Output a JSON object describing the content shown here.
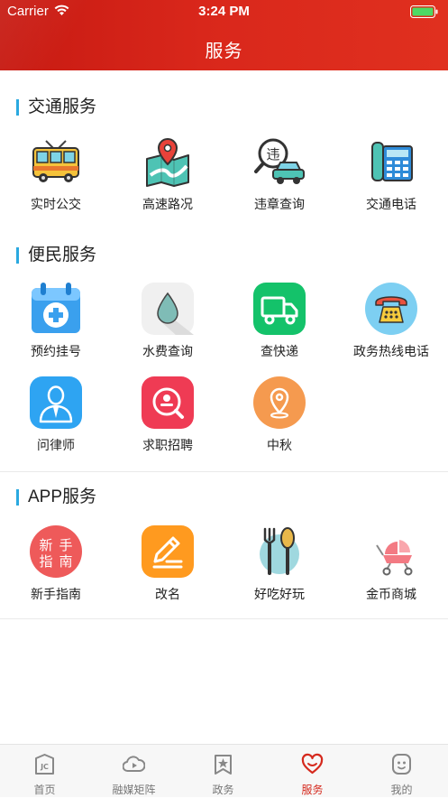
{
  "status_bar": {
    "carrier": "Carrier",
    "time": "3:24 PM"
  },
  "header": {
    "title": "服务"
  },
  "sections": {
    "traffic": {
      "title": "交通服务",
      "items": [
        {
          "label": "实时公交",
          "icon": "bus-icon"
        },
        {
          "label": "高速路况",
          "icon": "map-pin-icon"
        },
        {
          "label": "违章查询",
          "icon": "violation-search-icon"
        },
        {
          "label": "交通电话",
          "icon": "phone-calculator-icon"
        }
      ]
    },
    "convenience": {
      "title": "便民服务",
      "items": [
        {
          "label": "预约挂号",
          "icon": "medical-calendar-icon"
        },
        {
          "label": "水费查询",
          "icon": "water-drop-icon"
        },
        {
          "label": "查快递",
          "icon": "delivery-truck-icon"
        },
        {
          "label": "政务热线电话",
          "icon": "telephone-icon"
        },
        {
          "label": "问律师",
          "icon": "lawyer-icon"
        },
        {
          "label": "求职招聘",
          "icon": "job-search-icon"
        },
        {
          "label": "中秋",
          "icon": "location-pin-icon"
        }
      ]
    },
    "app": {
      "title": "APP服务",
      "items": [
        {
          "label": "新手指南",
          "icon": "beginner-guide-icon",
          "icon_text": [
            "新",
            "手",
            "指",
            "南"
          ]
        },
        {
          "label": "改名",
          "icon": "rename-pencil-icon"
        },
        {
          "label": "好吃好玩",
          "icon": "fork-spoon-icon"
        },
        {
          "label": "金币商城",
          "icon": "stroller-icon"
        }
      ]
    }
  },
  "tabbar": {
    "tabs": [
      {
        "label": "首页",
        "icon": "home-icon",
        "icon_text": "JC",
        "active": false
      },
      {
        "label": "融媒矩阵",
        "icon": "cloud-play-icon",
        "active": false
      },
      {
        "label": "政务",
        "icon": "star-bookmark-icon",
        "active": false
      },
      {
        "label": "服务",
        "icon": "heart-icon",
        "active": true
      },
      {
        "label": "我的",
        "icon": "profile-face-icon",
        "active": false
      }
    ]
  },
  "colors": {
    "header_red": "#d52a1e",
    "accent_blue": "#2aa9e0",
    "active_tab": "#d52a1e"
  }
}
